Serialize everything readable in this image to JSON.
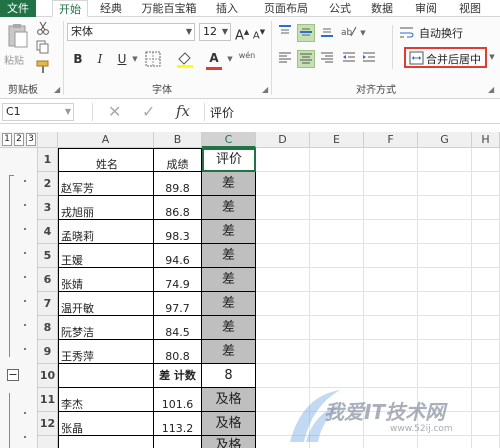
{
  "tabs": [
    "文件",
    "开始",
    "经典",
    "万能百宝箱",
    "插入",
    "页面布局",
    "公式",
    "数据",
    "审阅",
    "视图"
  ],
  "clipboard": {
    "paste_label": "粘贴",
    "group_label": "剪贴板"
  },
  "font": {
    "name": "宋体",
    "size": "12",
    "bold": "B",
    "italic": "I",
    "underline": "U",
    "grow": "A",
    "shrink": "A",
    "font_color_letter": "A",
    "wen": "wén",
    "group_label": "字体"
  },
  "alignment": {
    "wrap_label": "自动换行",
    "merge_label": "合并后居中",
    "group_label": "对齐方式"
  },
  "formula_bar": {
    "name_box": "C1",
    "fx": "fx",
    "value": "评价"
  },
  "outline_levels": [
    "1",
    "2",
    "3"
  ],
  "outline_button": "−",
  "columns": [
    "A",
    "B",
    "C",
    "D",
    "E",
    "F",
    "G",
    "H"
  ],
  "rows": [
    {
      "num": "1",
      "a": "姓名",
      "b": "成绩",
      "c": "评价"
    },
    {
      "num": "2",
      "a": "赵军芳",
      "b": "89.8",
      "c": "差"
    },
    {
      "num": "3",
      "a": "戎旭丽",
      "b": "86.8",
      "c": "差"
    },
    {
      "num": "4",
      "a": "孟晓莉",
      "b": "98.3",
      "c": "差"
    },
    {
      "num": "5",
      "a": "王媛",
      "b": "94.6",
      "c": "差"
    },
    {
      "num": "6",
      "a": "张婧",
      "b": "74.9",
      "c": "差"
    },
    {
      "num": "7",
      "a": "温开敏",
      "b": "97.7",
      "c": "差"
    },
    {
      "num": "8",
      "a": "阮梦洁",
      "b": "84.5",
      "c": "差"
    },
    {
      "num": "9",
      "a": "王秀萍",
      "b": "80.8",
      "c": "差"
    },
    {
      "num": "10",
      "a": "",
      "b": "差 计数",
      "c": "8"
    },
    {
      "num": "11",
      "a": "李杰",
      "b": "101.6",
      "c": "及格"
    },
    {
      "num": "12",
      "a": "张晶",
      "b": "113.2",
      "c": "及格"
    },
    {
      "num": "",
      "a": "",
      "b": "",
      "c": "及格"
    }
  ],
  "watermark": {
    "text": "我爱IT技术网",
    "url": "www.52ij.com"
  },
  "colors": {
    "accent": "#217346",
    "highlight": "#e03c31",
    "cell_gray": "#bfbfbf"
  }
}
